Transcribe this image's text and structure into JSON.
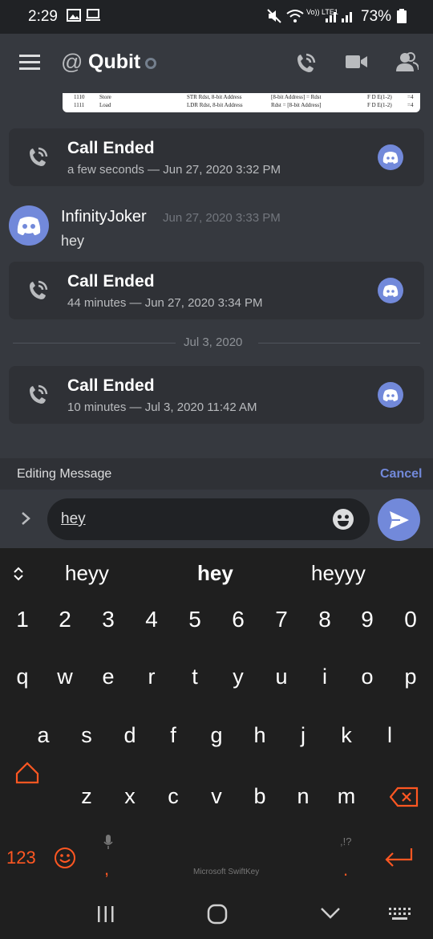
{
  "status_bar": {
    "time": "2:29",
    "network_label": "Vo)) LTE1",
    "battery": "73%"
  },
  "header": {
    "channel_name": "Qubit",
    "at_symbol": "@"
  },
  "document_snippet": {
    "rows": [
      {
        "code": "1110",
        "name": "Store",
        "syntax": "STR Rdst, 8-bit Address",
        "effect": "[8-bit Address] = Rdst",
        "cycle": "F D E(1-2)",
        "size": "=4"
      },
      {
        "code": "1111",
        "name": "Load",
        "syntax": "LDR Rdst, 8-bit Address",
        "effect": "Rdst = [8-bit Address]",
        "cycle": "F D E(1-2)",
        "size": "=4"
      }
    ]
  },
  "messages": {
    "call_1": {
      "title": "Call Ended",
      "subtitle": "a few seconds — Jun 27, 2020 3:32 PM"
    },
    "text_message": {
      "author": "InfinityJoker",
      "timestamp": "Jun 27, 2020 3:33 PM",
      "text": "hey"
    },
    "call_2": {
      "title": "Call Ended",
      "subtitle": "44 minutes — Jun 27, 2020 3:34 PM"
    },
    "date_divider": "Jul 3, 2020",
    "call_3": {
      "title": "Call Ended",
      "subtitle": "10 minutes — Jul 3, 2020 11:42 AM"
    }
  },
  "edit_bar": {
    "label": "Editing Message",
    "cancel": "Cancel"
  },
  "input": {
    "value": "hey"
  },
  "keyboard": {
    "suggestions": [
      "heyy",
      "hey",
      "heyyy"
    ],
    "number_row": [
      "1",
      "2",
      "3",
      "4",
      "5",
      "6",
      "7",
      "8",
      "9",
      "0"
    ],
    "row1": [
      "q",
      "w",
      "e",
      "r",
      "t",
      "y",
      "u",
      "i",
      "o",
      "p"
    ],
    "row2": [
      "a",
      "s",
      "d",
      "f",
      "g",
      "h",
      "j",
      "k",
      "l"
    ],
    "row3": [
      "z",
      "x",
      "c",
      "v",
      "b",
      "n",
      "m"
    ],
    "mode_key": "123",
    "comma": ",",
    "space_label": "Microsoft SwiftKey",
    "punct_hint": ",!?",
    "period": "."
  },
  "colors": {
    "blurple": "#7289da",
    "keyboard_accent": "#ff5722",
    "chat_bg": "#36393f",
    "card_bg": "#2f3136"
  },
  "icons": [
    "menu-icon",
    "call-icon",
    "video-icon",
    "members-icon",
    "phone-icon",
    "discord-logo-icon",
    "chevron-right-icon",
    "emoji-icon",
    "send-icon",
    "expand-icon",
    "shift-icon",
    "backspace-icon",
    "smile-icon",
    "mic-icon",
    "enter-icon",
    "recents-icon",
    "home-icon",
    "back-icon",
    "keyboard-switch-icon"
  ]
}
